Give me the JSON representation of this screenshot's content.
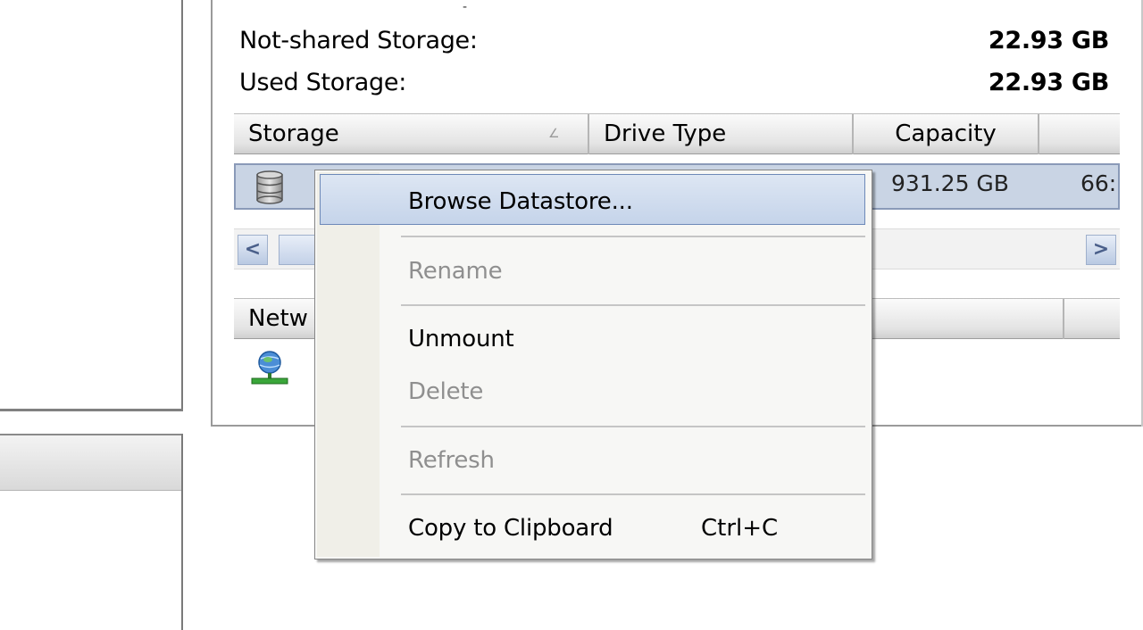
{
  "summary": {
    "partial_text": "-",
    "not_shared_label": "Not-shared Storage:",
    "not_shared_value": "22.93 GB",
    "used_label": "Used Storage:",
    "used_value": "22.93 GB"
  },
  "storage_table": {
    "columns": [
      "Storage",
      "Drive Type",
      "Capacity",
      ""
    ],
    "sort_glyph": "∠",
    "selected_row": {
      "capacity": "931.25 GB",
      "free_partial": "66:"
    }
  },
  "scrollbar": {
    "left_arrow": "<",
    "right_arrow": ">"
  },
  "network_table": {
    "columns": [
      "Netw"
    ]
  },
  "context_menu": {
    "items": [
      {
        "label": "Browse Datastore...",
        "enabled": true,
        "highlighted": true
      },
      {
        "label": "Rename",
        "enabled": false
      },
      {
        "label": "Unmount",
        "enabled": true
      },
      {
        "label": "Delete",
        "enabled": false
      },
      {
        "label": "Refresh",
        "enabled": false
      },
      {
        "label": "Copy to Clipboard",
        "enabled": true,
        "shortcut": "Ctrl+C"
      }
    ]
  },
  "icons": {
    "datastore": "database-icon",
    "network": "network-globe-icon"
  },
  "colors": {
    "selection_bg": "#c9d4e4",
    "menu_highlight": "#c5d4ea",
    "disabled_text": "#8f8f8f"
  }
}
